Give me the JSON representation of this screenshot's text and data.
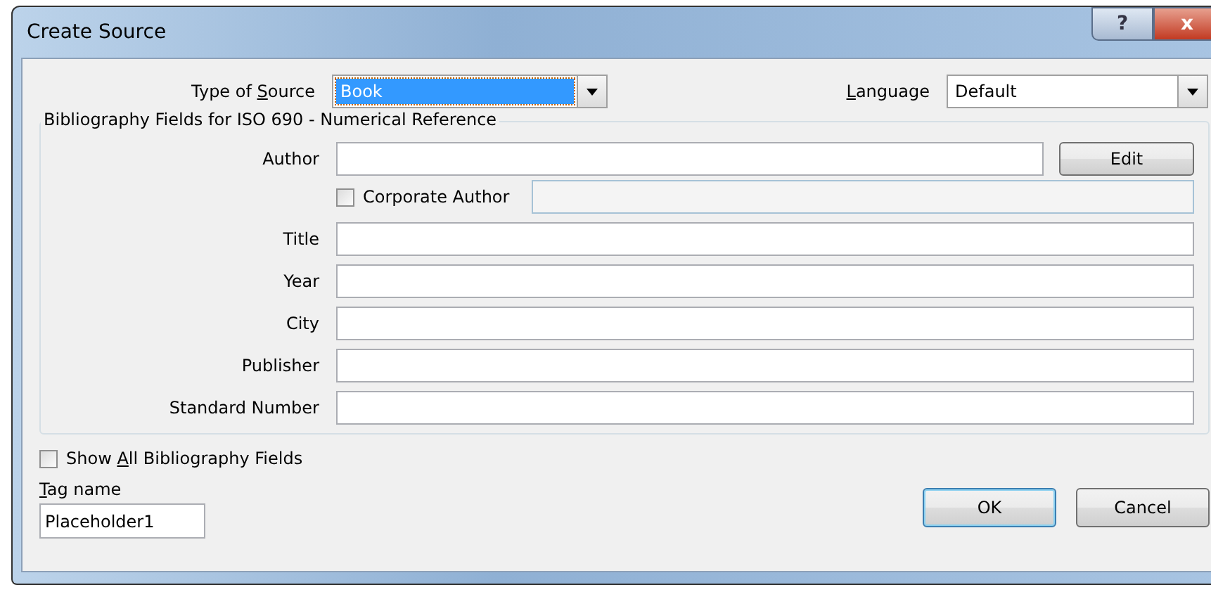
{
  "window": {
    "title": "Create Source",
    "buttons": [
      {
        "kind": "help",
        "label": "?"
      },
      {
        "kind": "close",
        "label": "x"
      }
    ]
  },
  "type_of_source": {
    "label": {
      "before": "Type of ",
      "access_key": "S",
      "after": "ource"
    },
    "value": "Book",
    "focused": true
  },
  "language": {
    "label": {
      "access_key": "L",
      "after": "anguage"
    },
    "value": "Default",
    "focused": false
  },
  "group": {
    "title": "Bibliography Fields for ISO 690 - Numerical Reference",
    "author": {
      "label": "Author"
    },
    "edit_button": "Edit",
    "corporate_author": {
      "label": "Corporate Author",
      "checked": false
    },
    "fields": [
      {
        "label": "Title"
      },
      {
        "label": "Year"
      },
      {
        "label": "City"
      },
      {
        "label": "Publisher"
      },
      {
        "label": "Standard Number"
      }
    ]
  },
  "show_all": {
    "label": {
      "before": "Show ",
      "access_key": "A",
      "after": "ll Bibliography Fields"
    },
    "checked": false
  },
  "tag_name": {
    "label": {
      "access_key": "T",
      "after": "ag name"
    },
    "value": "Placeholder1"
  },
  "buttons": [
    {
      "label": "OK",
      "default": true
    },
    {
      "label": "Cancel",
      "default": false
    }
  ]
}
